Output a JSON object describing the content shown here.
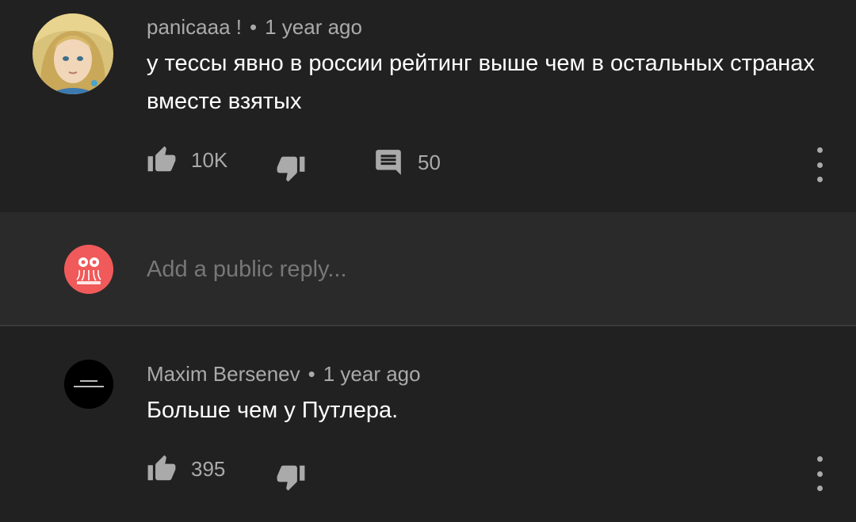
{
  "comments": [
    {
      "author": "panicaaa !",
      "time": "1 year ago",
      "text": "у тессы явно в россии рейтинг выше чем в остальных странах вместе взятых",
      "likes": "10K",
      "replies": "50"
    },
    {
      "author": "Maxim Bersenev",
      "time": "1 year ago",
      "text": "Больше чем у Путлера.",
      "likes": "395"
    }
  ],
  "reply": {
    "placeholder": "Add a public reply..."
  },
  "icons": {
    "like": "thumbs-up-icon",
    "dislike": "thumbs-down-icon",
    "reply": "comment-icon",
    "more": "more-vertical-icon"
  },
  "colors": {
    "background": "#212121",
    "reply_background": "#2a2a2a",
    "secondary_text": "#aaaaaa",
    "user_avatar": "#f05a5a"
  }
}
